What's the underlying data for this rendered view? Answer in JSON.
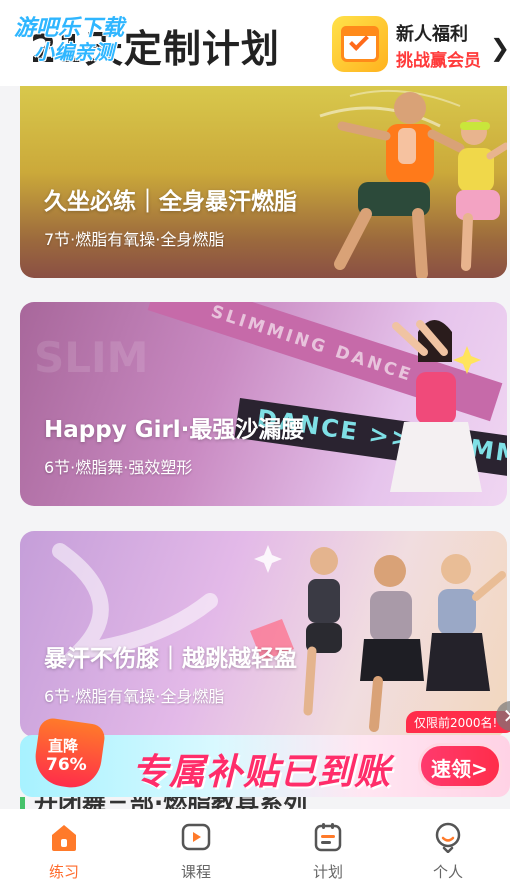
{
  "header": {
    "title": "21天定制计划",
    "watermark": {
      "line1": "游吧乐下载",
      "line2": "小编亲测"
    },
    "promo": {
      "title": "新人福利",
      "subtitle": "挑战赢会员",
      "arrow": "❯",
      "icon": "calendar-check-icon"
    }
  },
  "cards": [
    {
      "title": "久坐必练｜全身暴汗燃脂",
      "subtitle": "7节·燃脂有氧操·全身燃脂"
    },
    {
      "title": "Happy Girl·最强沙漏腰",
      "subtitle": "6节·燃脂舞·强效塑形",
      "ribbon_top": "SLIMMING DANCE >>",
      "ribbon_mid": "DANCE >> SLIMMIN"
    },
    {
      "title": "暴汗不伤膝｜越跳越轻盈",
      "subtitle": "6节·燃脂有氧操·全身燃脂"
    }
  ],
  "banner": {
    "badge_line1": "直降",
    "badge_line2": "76%",
    "text": "专属补贴已到账",
    "button": "速领>",
    "tag": "仅限前2000名!",
    "close": "✕"
  },
  "peek_section": {
    "text": "开闭舞三部·燃脂教具系列"
  },
  "tabbar": {
    "items": [
      {
        "label": "练习",
        "icon": "home-icon",
        "active": true
      },
      {
        "label": "课程",
        "icon": "play-icon",
        "active": false
      },
      {
        "label": "计划",
        "icon": "plan-list-icon",
        "active": false
      },
      {
        "label": "个人",
        "icon": "profile-icon",
        "active": false
      }
    ]
  },
  "colors": {
    "accent": "#ff6a2a",
    "banner_pink": "#ff2d6a",
    "promo_red": "#ff3b3b"
  }
}
